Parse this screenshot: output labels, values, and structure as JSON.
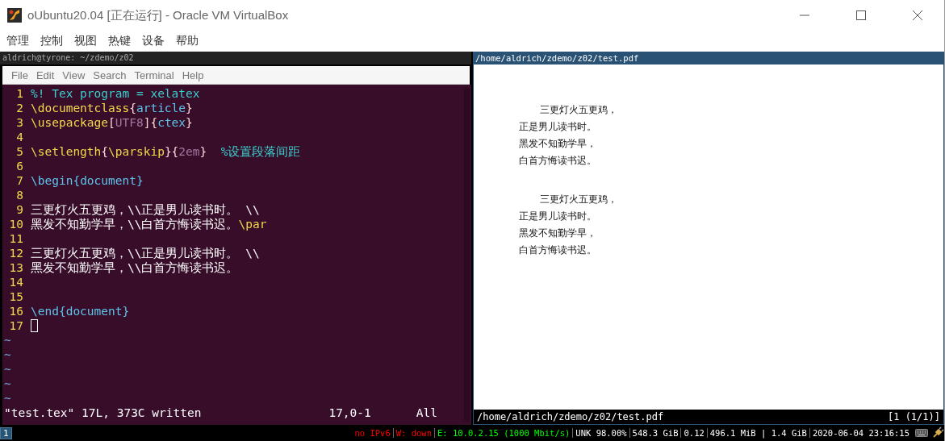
{
  "window": {
    "title": "oUbuntu20.04 [正在运行] - Oracle VM VirtualBox"
  },
  "menu": [
    "管理",
    "控制",
    "视图",
    "热键",
    "设备",
    "帮助"
  ],
  "terminal": {
    "title": "aldrich@tyrone: ~/zdemo/z02",
    "menu": [
      "File",
      "Edit",
      "View",
      "Search",
      "Terminal",
      "Help"
    ],
    "lines": [
      {
        "number": "1",
        "segments": [
          {
            "text": "%! Tex program = xelatex",
            "kind": "comment"
          }
        ]
      },
      {
        "number": "2",
        "segments": [
          {
            "text": "\\documentclass",
            "kind": "command"
          },
          {
            "text": "{",
            "kind": "brace"
          },
          {
            "text": "article",
            "kind": "arg"
          },
          {
            "text": "}",
            "kind": "brace"
          }
        ]
      },
      {
        "number": "3",
        "segments": [
          {
            "text": "\\usepackage",
            "kind": "command"
          },
          {
            "text": "[",
            "kind": "brace"
          },
          {
            "text": "UTF8",
            "kind": "option"
          },
          {
            "text": "]{",
            "kind": "brace"
          },
          {
            "text": "ctex",
            "kind": "arg"
          },
          {
            "text": "}",
            "kind": "brace"
          }
        ]
      },
      {
        "number": "4"
      },
      {
        "number": "5",
        "segments": [
          {
            "text": "\\setlength",
            "kind": "command"
          },
          {
            "text": "{",
            "kind": "brace"
          },
          {
            "text": "\\parskip",
            "kind": "command"
          },
          {
            "text": "}{",
            "kind": "brace"
          },
          {
            "text": "2em",
            "kind": "option"
          },
          {
            "text": "}",
            "kind": "brace"
          },
          {
            "text": "  %设置段落间距",
            "kind": "comment"
          }
        ]
      },
      {
        "number": "6"
      },
      {
        "number": "7",
        "segments": [
          {
            "text": "\\begin",
            "kind": "arg"
          },
          {
            "text": "{",
            "kind": "arg"
          },
          {
            "text": "document",
            "kind": "arg"
          },
          {
            "text": "}",
            "kind": "arg"
          }
        ]
      },
      {
        "number": "8"
      },
      {
        "number": "9",
        "segments": [
          {
            "text": "三更灯火五更鸡，\\\\正是男儿读书时。 \\\\",
            "kind": "text"
          }
        ]
      },
      {
        "number": "10",
        "segments": [
          {
            "text": "黑发不知勤学早，\\\\白首方悔读书迟。",
            "kind": "text"
          },
          {
            "text": "\\par",
            "kind": "command"
          }
        ]
      },
      {
        "number": "11"
      },
      {
        "number": "12",
        "segments": [
          {
            "text": "三更灯火五更鸡，\\\\正是男儿读书时。 \\\\",
            "kind": "text"
          }
        ]
      },
      {
        "number": "13",
        "segments": [
          {
            "text": "黑发不知勤学早，\\\\白首方悔读书迟。",
            "kind": "text"
          }
        ]
      },
      {
        "number": "14"
      },
      {
        "number": "15"
      },
      {
        "number": "16",
        "segments": [
          {
            "text": "\\end",
            "kind": "arg"
          },
          {
            "text": "{",
            "kind": "arg"
          },
          {
            "text": "document",
            "kind": "arg"
          },
          {
            "text": "}",
            "kind": "arg"
          }
        ]
      },
      {
        "number": "17",
        "cursor": true
      }
    ],
    "tildes": [
      "~",
      "~",
      "~",
      "~",
      "~"
    ],
    "status": {
      "message": "\"test.tex\" 17L, 373C written",
      "position": "17,0-1",
      "scroll": "All"
    }
  },
  "pdf_viewer": {
    "title": "/home/aldrich/zdemo/z02/test.pdf",
    "stanzas": [
      [
        "三更灯火五更鸡，",
        "正是男儿读书时。",
        "黑发不知勤学早，",
        "白首方悔读书迟。"
      ],
      [
        "三更灯火五更鸡，",
        "正是男儿读书时。",
        "黑发不知勤学早，",
        "白首方悔读书迟。"
      ]
    ],
    "path": "/home/aldrich/zdemo/z02/test.pdf",
    "page": "[1 (1/1)]"
  },
  "bar": {
    "workspaces": [
      {
        "label": "1",
        "selected": true
      }
    ],
    "status": [
      {
        "text": "no IPv6",
        "color": "#ff0000"
      },
      {
        "text": "W: down",
        "color": "#ff0000"
      },
      {
        "text": "E: 10.0.2.15 (1000 Mbit/s)",
        "color": "#00ff00"
      },
      {
        "text": "UNK 98.00%",
        "color": "#ffffff"
      },
      {
        "text": "548.3 GiB",
        "color": "#ffffff"
      },
      {
        "text": "0.12",
        "color": "#ffffff"
      },
      {
        "text": "496.1 MiB | 1.4 GiB",
        "color": "#ffffff"
      },
      {
        "text": "2020-06-04 23:16:15",
        "color": "#ffffff"
      }
    ]
  }
}
